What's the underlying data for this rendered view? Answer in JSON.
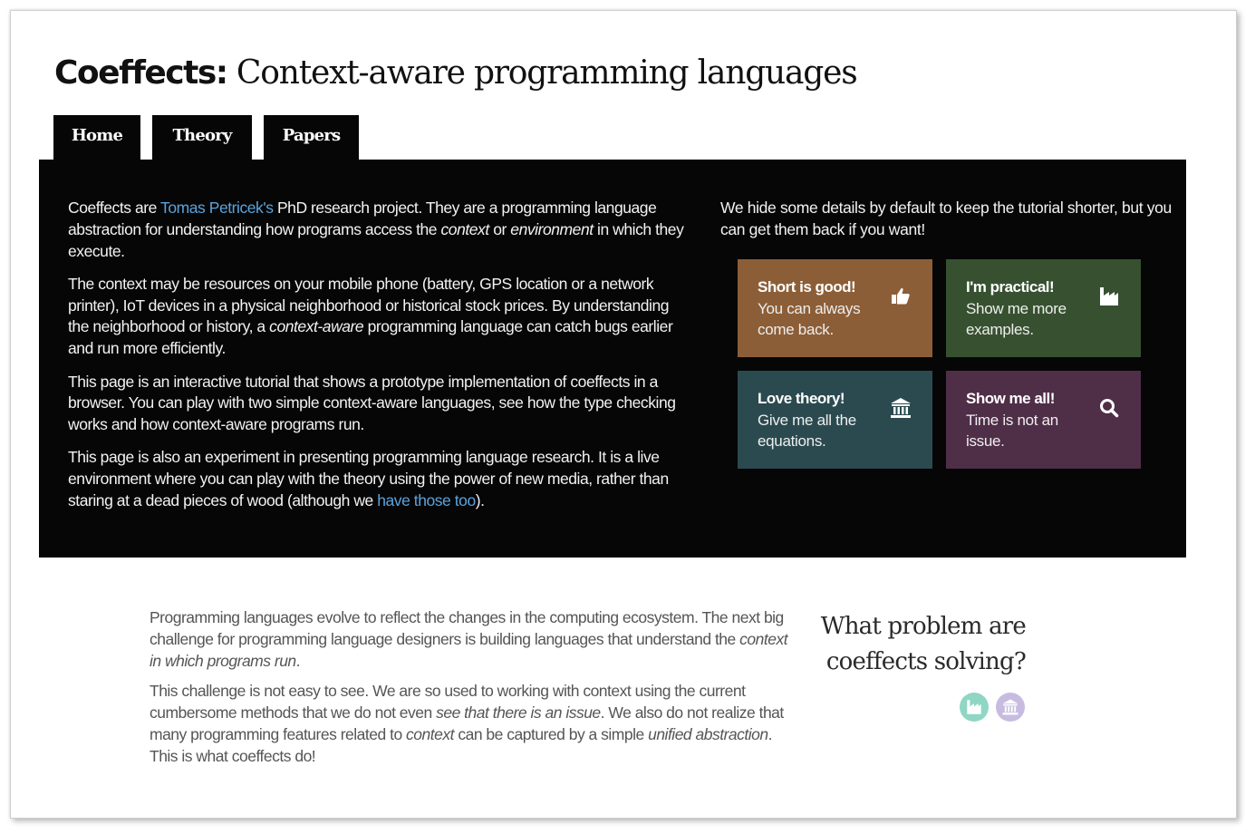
{
  "header": {
    "title_bold": "Coeffects:",
    "title_rest": " Context-aware programming languages"
  },
  "tabs": [
    {
      "label": "Home",
      "active": true
    },
    {
      "label": "Theory",
      "active": false
    },
    {
      "label": "Papers",
      "active": false
    }
  ],
  "hero": {
    "paragraphs": {
      "p1": {
        "before": "Coeffects are ",
        "link": "Tomas Petricek's",
        "mid": " PhD research project. They are a programming language abstraction for understanding how programs access the ",
        "em1": "context",
        "mid2": " or ",
        "em2": "environment",
        "after": " in which they execute."
      },
      "p2": {
        "before": "The context may be resources on your mobile phone (battery, GPS location or a network printer), IoT devices in a physical neighborhood or historical stock prices. By understanding the neighborhood or history, a ",
        "em": "context-aware",
        "after": " programming language can catch bugs earlier and run more efficiently."
      },
      "p3": "This page is an interactive tutorial that shows a prototype implementation of coeffects in a browser. You can play with two simple context-aware languages, see how the type checking works and how context-aware programs run.",
      "p4": {
        "before": "This page is also an experiment in presenting programming language research. It is a live environment where you can play with the theory using the power of new media, rather than staring at a dead pieces of wood (although we ",
        "link": "have those too",
        "after": ")."
      }
    },
    "intro": "We hide some details by default to keep the tutorial shorter, but you can get them back if you want!",
    "tiles": [
      {
        "heading": "Short is good!",
        "text": "You can always come back.",
        "icon": "thumbs-up-icon",
        "color": "#8c5e37"
      },
      {
        "heading": "I'm practical!",
        "text": "Show me more examples.",
        "icon": "factory-icon",
        "color": "#375130"
      },
      {
        "heading": "Love theory!",
        "text": "Give me all the equations.",
        "icon": "institution-icon",
        "color": "#2b4a50"
      },
      {
        "heading": "Show me all!",
        "text": "Time is not an issue.",
        "icon": "search-icon",
        "color": "#4f2e48"
      }
    ]
  },
  "section": {
    "p1": {
      "before": "Programming languages evolve to reflect the changes in the computing ecosystem. The next big challenge for programming language designers is building languages that understand the ",
      "em": "context in which programs run",
      "after": "."
    },
    "p2": {
      "before": "This challenge is not easy to see. We are so used to working with context using the current cumbersome methods that we do not even ",
      "em1": "see that there is an issue",
      "mid": ". We also do not realize that many programming features related to ",
      "em2": "context",
      "mid2": " can be captured by a simple ",
      "em3": "unified abstraction",
      "after": ". This is what coeffects do!"
    },
    "aside_title": "What problem are coeffects solving?",
    "aside_icons": [
      "factory-icon",
      "institution-icon"
    ]
  },
  "colors": {
    "link": "#5ba3dd",
    "hero_bg": "#060606",
    "practical_circle": "#8fd6c4",
    "theory_circle": "#c7bce0"
  }
}
